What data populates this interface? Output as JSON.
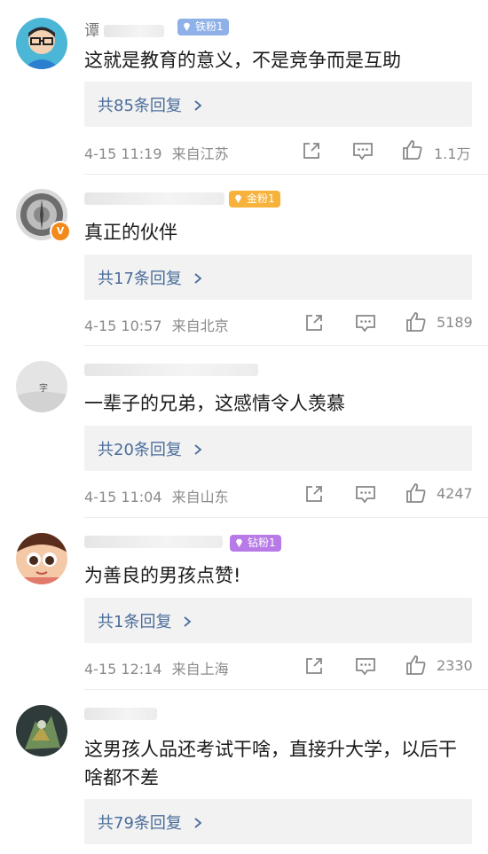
{
  "comments": [
    {
      "username": "谭",
      "badge": "铁粉1",
      "text": "这就是教育的意义，不是竞争而是互助",
      "replies": "共85条回复",
      "time": "4-15 11:19",
      "location": "来自江苏",
      "likes": "1.1万"
    },
    {
      "username": "",
      "badge": "金粉1",
      "text": "真正的伙伴",
      "replies": "共17条回复",
      "time": "4-15 10:57",
      "location": "来自北京",
      "likes": "5189"
    },
    {
      "username": "",
      "badge": "",
      "text": "一辈子的兄弟，这感情令人羡慕",
      "replies": "共20条回复",
      "time": "4-15 11:04",
      "location": "来自山东",
      "likes": "4247"
    },
    {
      "username": "",
      "badge": "钻粉1",
      "text": "为善良的男孩点赞!",
      "replies": "共1条回复",
      "time": "4-15 12:14",
      "location": "来自上海",
      "likes": "2330"
    },
    {
      "username": "",
      "badge": "",
      "text": "这男孩人品还考试干啥，直接升大学，以后干啥都不差",
      "replies": "共79条回复"
    }
  ],
  "icons": {
    "share": "share-icon",
    "comment": "comment-icon",
    "like": "thumbs-up-icon",
    "chevron": "chevron-right-icon",
    "verified": "verified-v-icon"
  },
  "verified_badge": "V",
  "colors": {
    "reply_link": "#4a6d9b",
    "badge_iron": "#8fb1e8",
    "badge_gold": "#f7b23b",
    "badge_diamond": "#b77ae6",
    "verified": "#f28a1c"
  }
}
